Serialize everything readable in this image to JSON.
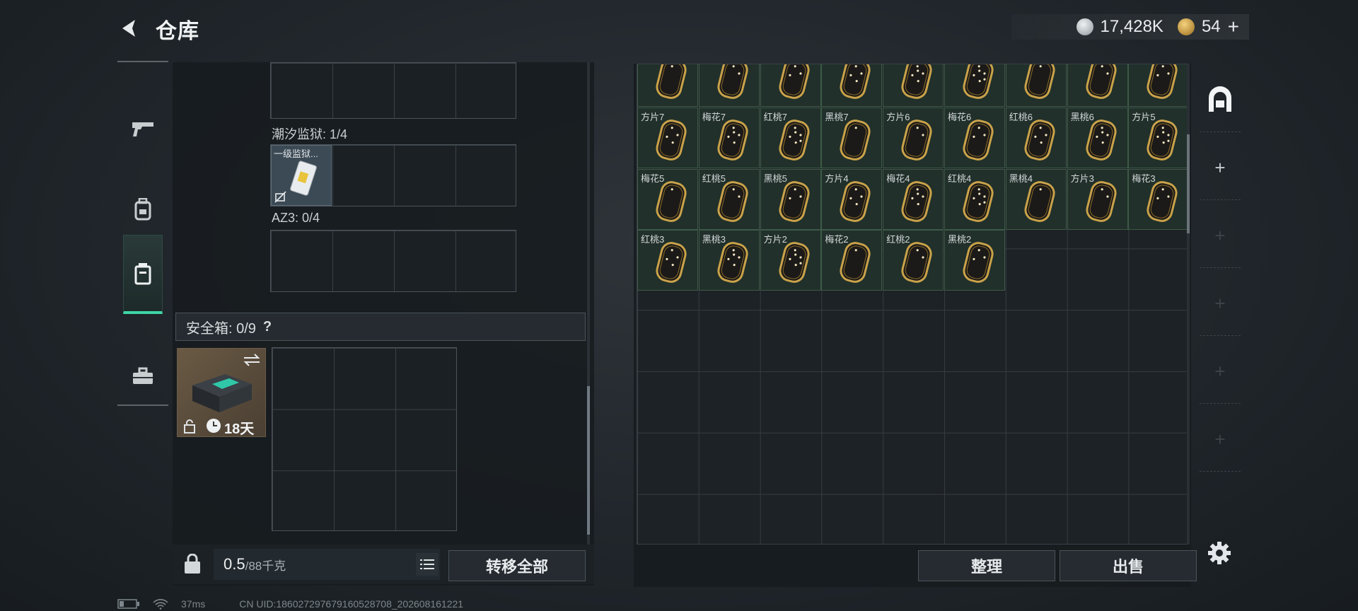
{
  "header": {
    "title": "仓库",
    "back_icon": "back-arrow-icon"
  },
  "currency": {
    "silver": "17,428K",
    "gold": "54",
    "add": "+",
    "silver_color": "#b9c0c5",
    "gold_color": "#d9a441"
  },
  "left_tabs": [
    {
      "icon": "gun-icon"
    },
    {
      "icon": "backpack-icon"
    },
    {
      "icon": "container-icon",
      "active": true
    },
    {
      "icon": "toolbox-icon"
    }
  ],
  "left_panel": {
    "tide_prison_label": "潮汐监狱: 1/4",
    "tide_item_label": "一级监狱...",
    "az3_label": "AZ3: 0/4",
    "safe_label": "安全箱: 0/9",
    "safe_help": "?",
    "safe_timer": "18天"
  },
  "bottom_left": {
    "weight_value": "0.5",
    "weight_max": "/88千克",
    "transfer_all": "转移全部"
  },
  "cards": {
    "row0": [
      "",
      "",
      "",
      "",
      "",
      "",
      "",
      "",
      ""
    ],
    "row1": [
      "方片7",
      "梅花7",
      "红桃7",
      "黑桃7",
      "方片6",
      "梅花6",
      "红桃6",
      "黑桃6",
      "方片5"
    ],
    "row2": [
      "梅花5",
      "红桃5",
      "黑桃5",
      "方片4",
      "梅花4",
      "红桃4",
      "黑桃4",
      "方片3",
      "梅花3"
    ],
    "row3": [
      "红桃3",
      "黑桃3",
      "方片2",
      "梅花2",
      "红桃2",
      "黑桃2"
    ]
  },
  "bottom_right": {
    "sort": "整理",
    "sell": "出售"
  },
  "side_strip": {
    "add": "+"
  },
  "status": {
    "ping": "37ms",
    "uid": "CN UID:18602729767916052870​8_202608161221"
  }
}
